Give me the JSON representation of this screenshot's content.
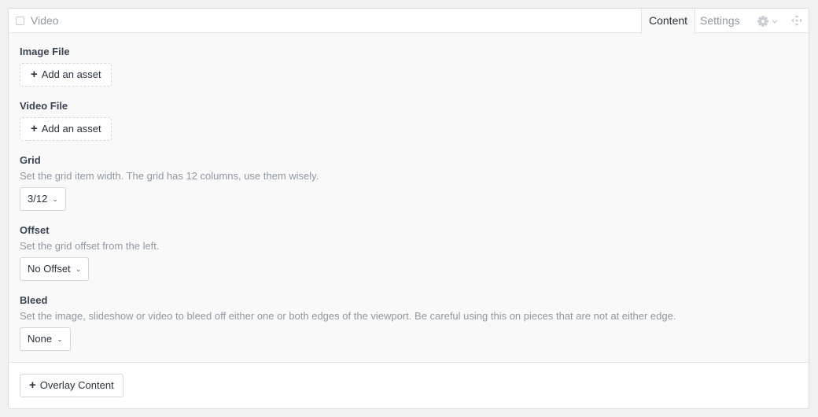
{
  "block": {
    "title": "Video",
    "tabs": [
      {
        "label": "Content",
        "active": true
      },
      {
        "label": "Settings",
        "active": false
      }
    ]
  },
  "fields": {
    "image_file": {
      "label": "Image File",
      "button": "Add an asset"
    },
    "video_file": {
      "label": "Video File",
      "button": "Add an asset"
    },
    "grid": {
      "label": "Grid",
      "help": "Set the grid item width. The grid has 12 columns, use them wisely.",
      "value": "3/12"
    },
    "offset": {
      "label": "Offset",
      "help": "Set the grid offset from the left.",
      "value": "No Offset"
    },
    "bleed": {
      "label": "Bleed",
      "help": "Set the image, slideshow or video to bleed off either one or both edges of the viewport. Be careful using this on pieces that are not at either edge.",
      "value": "None"
    }
  },
  "footer": {
    "overlay_button": "Overlay Content"
  },
  "icons": {
    "add": "plus-icon",
    "select": "chevron-down-icon",
    "settings": "gear-icon",
    "drag": "move-icon"
  },
  "colors": {
    "panel_bg": "#f9f9f9",
    "text": "#29323d",
    "muted": "#8f98a3",
    "border": "#dcdde0"
  }
}
